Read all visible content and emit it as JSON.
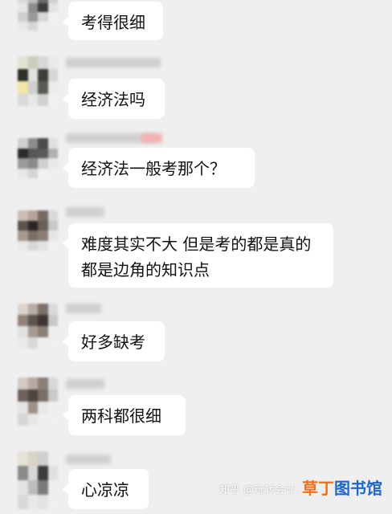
{
  "messages": [
    {
      "text": "考得很细"
    },
    {
      "text": "经济法吗"
    },
    {
      "text": "经济法一般考那个？"
    },
    {
      "text": "难度其实不大 但是考的都是真的都是边角的知识点"
    },
    {
      "text": "好多缺考"
    },
    {
      "text": "两科都很细"
    },
    {
      "text": "心凉凉"
    }
  ],
  "watermark": {
    "zhihu": "知乎 @玩转会计",
    "brand_part1": "草丁",
    "brand_part2": "图书馆"
  },
  "colors": {
    "background": "#efefef",
    "bubble": "#ffffff",
    "text": "#111111",
    "brand_orange": "#f36d16",
    "brand_blue": "#1e66d2"
  }
}
